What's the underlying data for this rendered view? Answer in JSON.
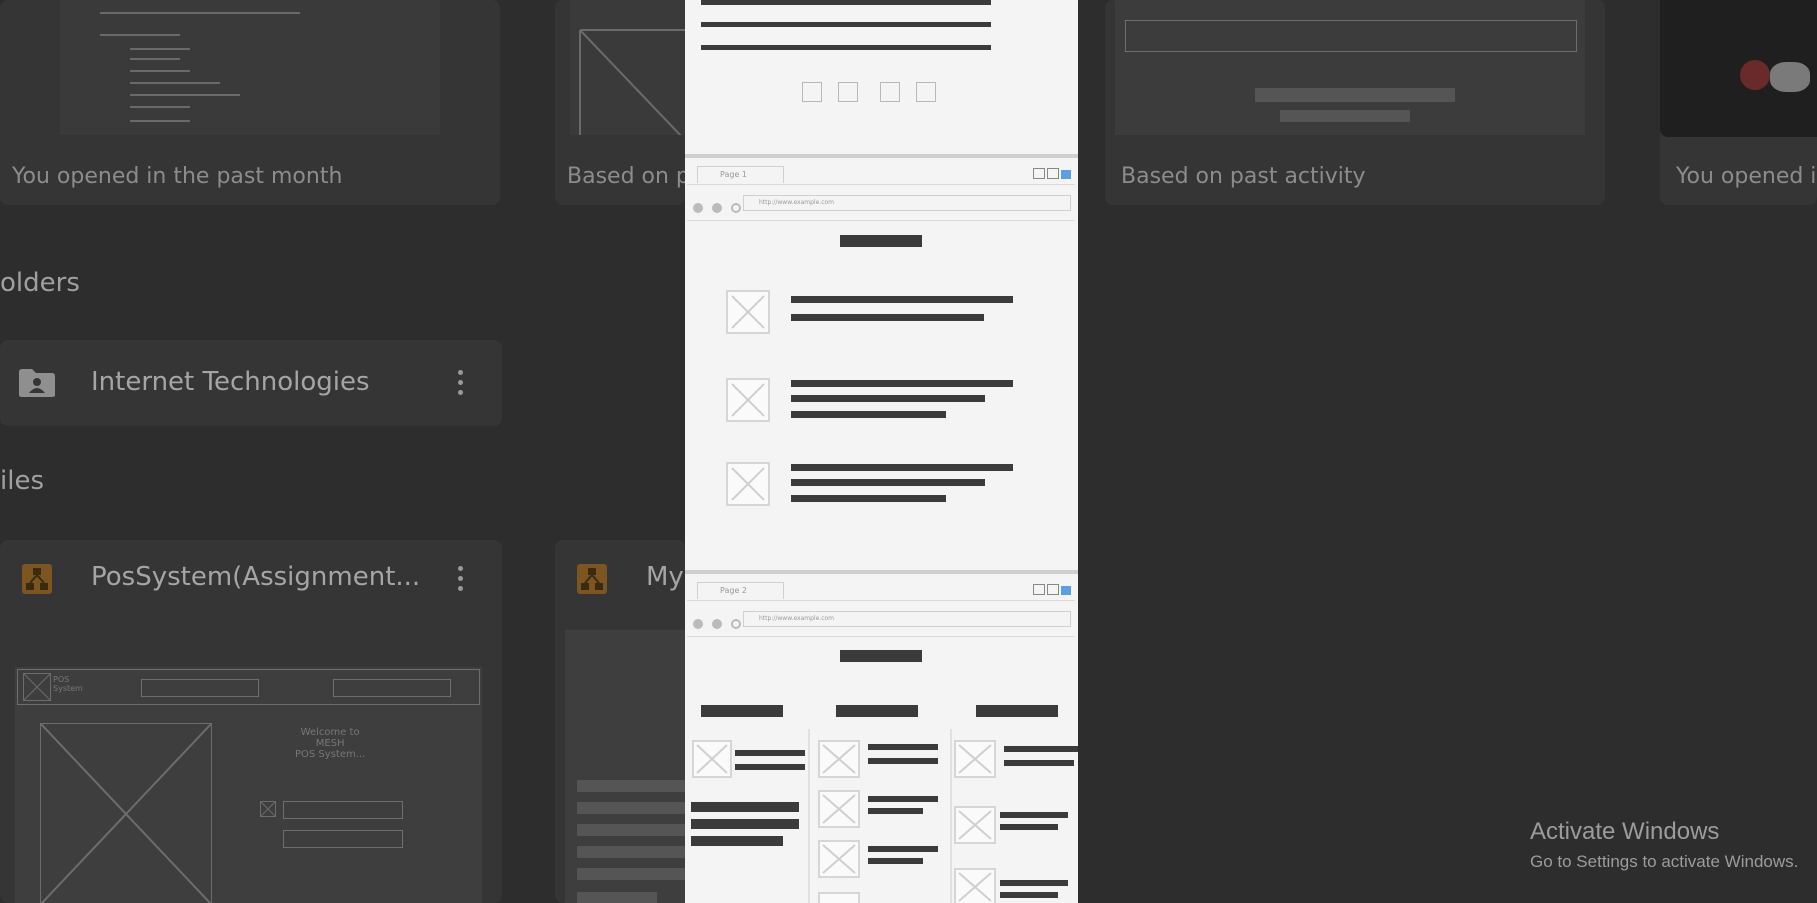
{
  "background": {
    "suggested_cards": [
      {
        "caption": "You opened in the past month"
      },
      {
        "caption": "Based on p"
      },
      {
        "caption": "Based on past activity"
      },
      {
        "caption": "You opened i"
      }
    ],
    "folders_heading": "olders",
    "folders": [
      {
        "name": "Internet Technologies",
        "icon": "shared-folder-icon"
      }
    ],
    "files_heading": "iles",
    "files": [
      {
        "name": "PosSystem(Assignment...",
        "icon": "drawio-file-icon"
      },
      {
        "name": "My",
        "icon": "drawio-file-icon"
      }
    ],
    "pos_wireframe": {
      "logo_text": "POS\nSystem",
      "welcome_text": "Welcome to\nMESH\nPOS System..."
    }
  },
  "viewer": {
    "pages": [
      {
        "tab_label": "Page 1",
        "address": "http://www.example.com"
      },
      {
        "tab_label": "Page 2",
        "address": "http://www.example.com"
      }
    ]
  },
  "watermark": {
    "title": "Activate Windows",
    "subtitle": "Go to Settings to activate Windows."
  },
  "colors": {
    "overlay_bg": "#2d2d2d",
    "viewer_bg": "#f4f4f4",
    "file_icon": "#c07a20"
  }
}
